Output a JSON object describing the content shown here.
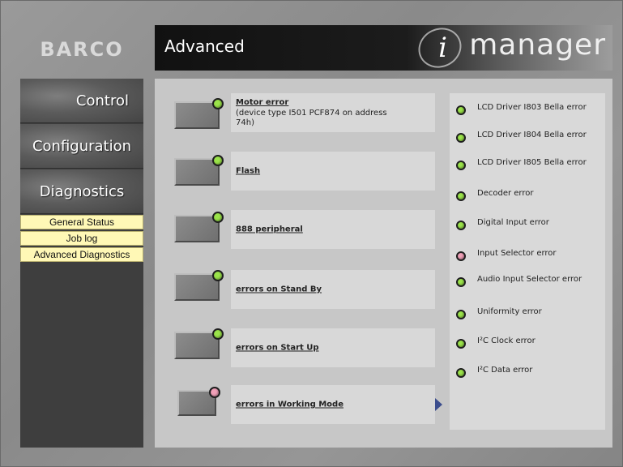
{
  "logo": "BARCO",
  "header": {
    "title": "Advanced",
    "brand_i": "i",
    "brand": "manager"
  },
  "nav": {
    "control": "Control",
    "configuration": "Configuration",
    "diagnostics": "Diagnostics",
    "submenu": [
      "General Status",
      "Job log",
      "Advanced Diagnostics"
    ]
  },
  "rows": [
    {
      "label": "Motor error",
      "sub": "(device type I501 PCF874 on address 74h)",
      "status": "ok"
    },
    {
      "label": "Flash",
      "sub": "",
      "status": "ok"
    },
    {
      "label": "888 peripheral",
      "sub": "",
      "status": "ok"
    },
    {
      "label": "errors on Stand By",
      "sub": "",
      "status": "ok"
    },
    {
      "label": "errors on Start Up",
      "sub": "",
      "status": "ok"
    },
    {
      "label": "errors in Working Mode",
      "sub": "",
      "status": "error"
    }
  ],
  "errors": [
    {
      "label": "LCD Driver I803 Bella error",
      "status": "ok"
    },
    {
      "label": "LCD Driver I804 Bella error",
      "status": "ok"
    },
    {
      "label": "LCD Driver I805 Bella error",
      "status": "ok"
    },
    {
      "label": "Decoder error",
      "status": "ok"
    },
    {
      "label": "Digital Input error",
      "status": "ok"
    },
    {
      "label": "Input Selector error",
      "status": "error"
    },
    {
      "label": "Audio Input Selector error",
      "status": "ok"
    },
    {
      "label": "Uniformity error",
      "status": "ok"
    },
    {
      "label": "I²C Clock error",
      "status": "ok"
    },
    {
      "label": "I²C Data error",
      "status": "ok"
    }
  ],
  "colors": {
    "ok": "#9be34a",
    "error": "#f0a0b8",
    "arrow": "#3b4d8d"
  }
}
